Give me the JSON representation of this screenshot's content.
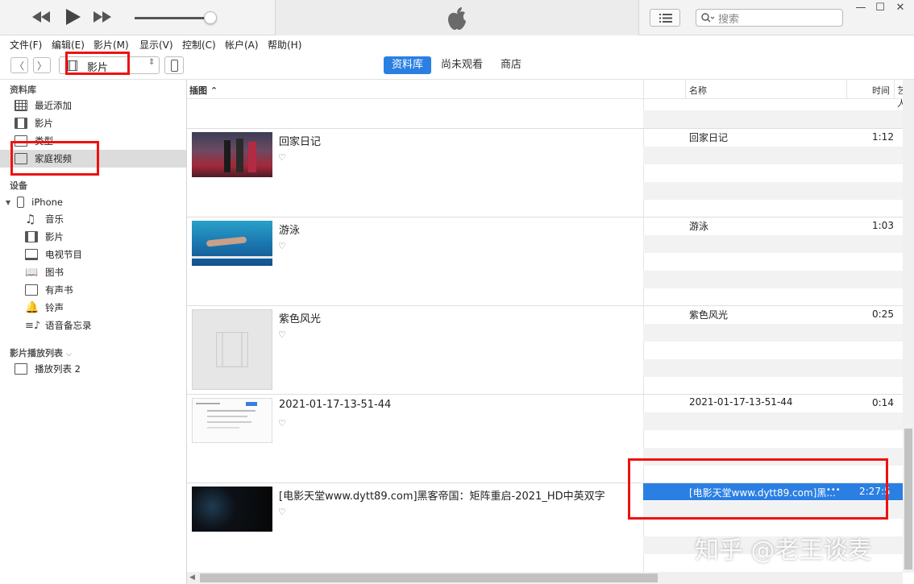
{
  "search": {
    "placeholder": "搜索"
  },
  "menu": [
    "文件(F)",
    "编辑(E)",
    "影片(M)",
    "显示(V)",
    "控制(C)",
    "帐户(A)",
    "帮助(H)"
  ],
  "nav": {
    "media_select": "影片",
    "tabs": [
      "资料库",
      "尚未观看",
      "商店"
    ]
  },
  "sidebar": {
    "library_header": "资料库",
    "library_items": [
      "最近添加",
      "影片",
      "类型",
      "家庭视频"
    ],
    "devices_header": "设备",
    "device_name": "iPhone",
    "device_items": [
      "音乐",
      "影片",
      "电视节目",
      "图书",
      "有声书",
      "铃声",
      "语音备忘录"
    ],
    "playlists_header": "影片播放列表",
    "playlist_items": [
      "播放列表 2"
    ]
  },
  "columns": {
    "artwork": "插图",
    "name": "名称",
    "time": "时间",
    "artist": "艺人"
  },
  "videos": [
    {
      "title": "回家日记",
      "name": "回家日记",
      "time": "1:12"
    },
    {
      "title": "游泳",
      "name": "游泳",
      "time": "1:03"
    },
    {
      "title": "紫色风光",
      "name": "紫色风光",
      "time": "0:25"
    },
    {
      "title": "2021-01-17-13-51-44",
      "name": "2021-01-17-13-51-44",
      "time": "0:14"
    },
    {
      "title": "[电影天堂www.dytt89.com]黑客帝国：矩阵重启-2021_HD中英双字",
      "name": "[电影天堂www.dytt89.com]黑...",
      "time": "2:27:5"
    }
  ],
  "heart": "♡",
  "more": "•••",
  "watermark": "知乎 @老王谈麦",
  "colors": {
    "accent": "#2b7fe3",
    "highlight_box": "#e11111"
  }
}
